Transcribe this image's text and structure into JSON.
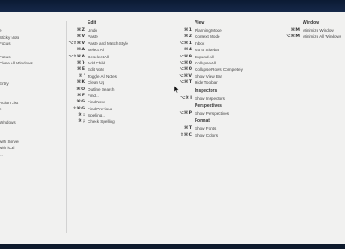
{
  "columns": {
    "left_partial": {
      "items": [
        {
          "label": "",
          "gap": 1
        },
        {
          "label": "e"
        },
        {
          "label": "Sticky Note"
        },
        {
          "label": "Focus"
        },
        {
          "label": "",
          "gap": 1
        },
        {
          "label": "Focus"
        },
        {
          "label": "Close All Windows"
        },
        {
          "label": "",
          "gap": 1
        },
        {
          "label": "",
          "gap": 1
        },
        {
          "label": "Entry"
        },
        {
          "label": "",
          "gap": 1
        },
        {
          "label": "",
          "gap": 1
        },
        {
          "label": "Action List"
        },
        {
          "label": "e"
        },
        {
          "label": "",
          "gap": 1
        },
        {
          "label": "Windows"
        },
        {
          "label": "",
          "gap": 1
        },
        {
          "label": "",
          "gap": 1
        },
        {
          "label": "with Server"
        },
        {
          "label": "with iCal"
        },
        {
          "label": "..."
        }
      ]
    },
    "edit": {
      "title": "Edit",
      "items": [
        {
          "shortcut": "⌘ Z",
          "label": "Undo"
        },
        {
          "shortcut": "⌘ V",
          "label": "Paste"
        },
        {
          "shortcut": "⌥⇧⌘ V",
          "label": "Paste and Match Style"
        },
        {
          "shortcut": "⌘ A",
          "label": "Select All"
        },
        {
          "shortcut": "⌥⇧⌘ A",
          "label": "Deselect All"
        },
        {
          "shortcut": "⌘ }",
          "label": "Add Child"
        },
        {
          "shortcut": "⌘ E",
          "label": "Edit Note"
        },
        {
          "shortcut": "⌘ '",
          "label": "Toggle All Notes"
        },
        {
          "shortcut": "⌘ K",
          "label": "Clean Up"
        },
        {
          "shortcut": "⌘ O",
          "label": "Outline Search"
        },
        {
          "shortcut": "⌘ F",
          "label": "Find..."
        },
        {
          "shortcut": "⌘ G",
          "label": "Find Next"
        },
        {
          "shortcut": "⇧⌘ G",
          "label": "Find Previous"
        },
        {
          "shortcut": "⌘ :",
          "label": "Spelling..."
        },
        {
          "shortcut": "⌘ ;",
          "label": "Check Spelling"
        }
      ]
    },
    "view": {
      "title": "View",
      "groups": [
        {
          "title": "",
          "items": [
            {
              "shortcut": "⌘ 1",
              "label": "Planning Mode"
            },
            {
              "shortcut": "⌘ 2",
              "label": "Context Mode"
            },
            {
              "shortcut": "⌥⌘ 1",
              "label": "Inbox"
            },
            {
              "shortcut": "⌘ 4",
              "label": "Go to Sidebar"
            },
            {
              "shortcut": "⌥⌘ 9",
              "label": "Expand All"
            },
            {
              "shortcut": "⌥⌘ 0",
              "label": "Collapse All"
            },
            {
              "shortcut": "⌥⌘ 0",
              "label": "Collapse Rows Completely"
            },
            {
              "shortcut": "⌥⌘ V",
              "label": "Show View Bar"
            },
            {
              "shortcut": "⌥⌘ T",
              "label": "Hide Toolbar"
            }
          ]
        },
        {
          "title": "Inspectors",
          "items": [
            {
              "shortcut": "⌥⌘ I",
              "label": "Show Inspectors"
            }
          ]
        },
        {
          "title": "Perspectives",
          "items": [
            {
              "shortcut": "⌥⌘ P",
              "label": "Show Perspectives"
            }
          ]
        },
        {
          "title": "Format",
          "items": [
            {
              "shortcut": "⌘ T",
              "label": "Show Fonts"
            },
            {
              "shortcut": "⇧⌘ C",
              "label": "Show Colors"
            }
          ]
        }
      ]
    },
    "window": {
      "title": "Window",
      "items": [
        {
          "shortcut": "⌘ M",
          "label": "Minimize Window"
        },
        {
          "shortcut": "⌥⌘ M",
          "label": "Minimize All Windows"
        }
      ]
    }
  },
  "colors": {
    "panel_bg": "#f1f1f0",
    "frame_top": "#0b1a33",
    "frame_bottom": "#0e1a2c",
    "text": "#444444",
    "divider": "#d2d2d2"
  }
}
